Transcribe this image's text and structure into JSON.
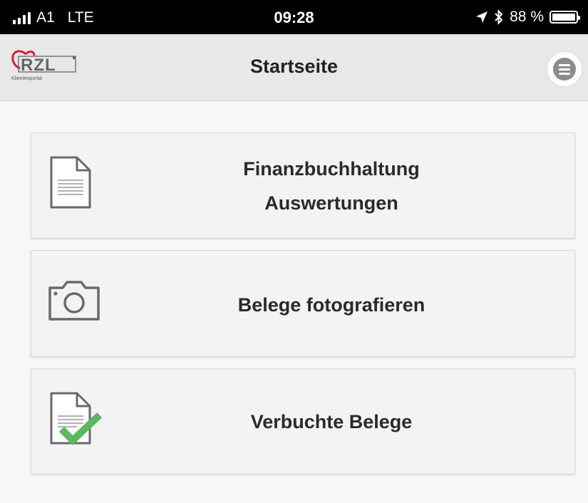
{
  "status_bar": {
    "carrier": "A1",
    "network": "LTE",
    "time": "09:28",
    "battery": "88 %"
  },
  "header": {
    "logo_text": "RZL",
    "logo_subtext": "Klientenportal",
    "title": "Startseite",
    "menu_icon": "hamburger-circle-icon"
  },
  "menu_items": [
    {
      "line1": "Finanzbuchhaltung",
      "line2": "Auswertungen",
      "icon": "document-icon"
    },
    {
      "label": "Belege fotografieren",
      "icon": "camera-icon"
    },
    {
      "label": "Verbuchte Belege",
      "icon": "document-check-icon"
    }
  ],
  "colors": {
    "status_bar_bg": "#000000",
    "header_bg": "#e8e8e8",
    "card_bg": "#f3f3f3",
    "icon_gray": "#6a6a6a",
    "check_green": "#5cb85c",
    "logo_red": "#d9232e"
  }
}
